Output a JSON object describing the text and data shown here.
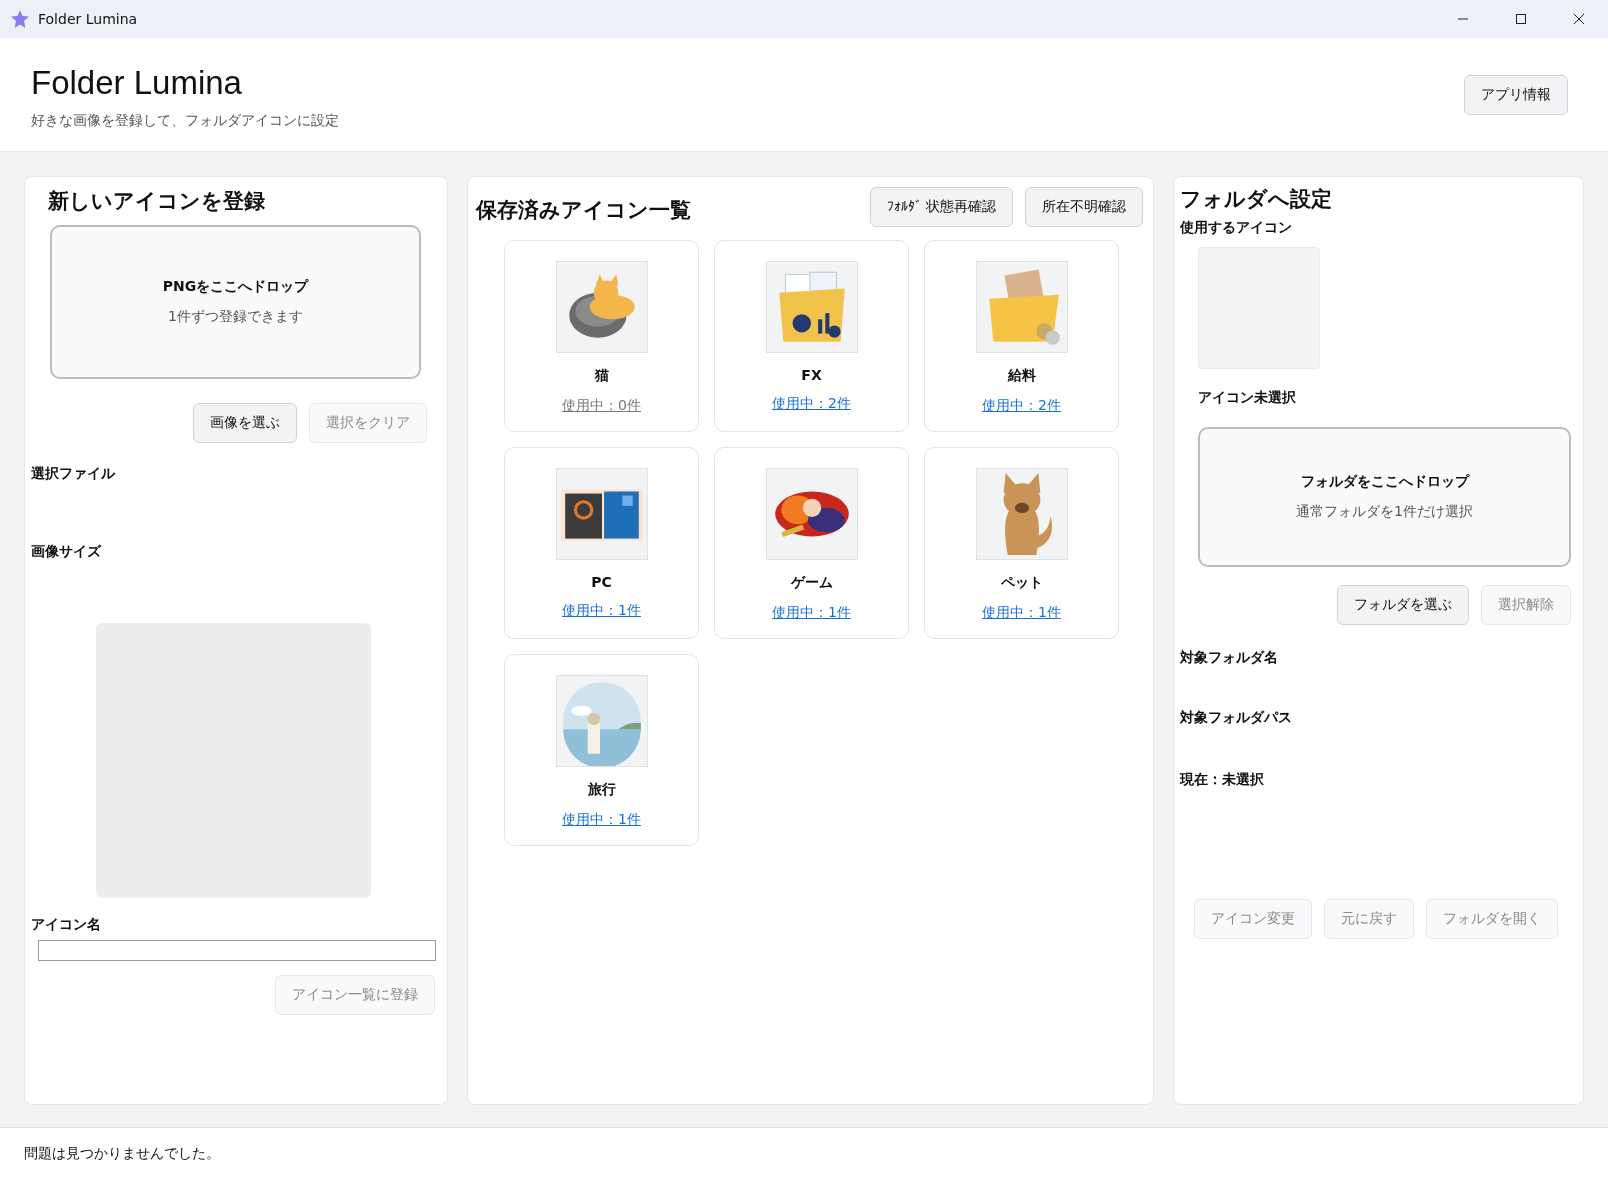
{
  "window": {
    "title": "Folder Lumina"
  },
  "header": {
    "title": "Folder Lumina",
    "subtitle": "好きな画像を登録して、フォルダアイコンに設定",
    "about_button": "アプリ情報"
  },
  "register_panel": {
    "title": "新しいアイコンを登録",
    "drop_title": "PNGをここへドロップ",
    "drop_hint": "1件ずつ登録できます",
    "buttons": [
      {
        "label": "画像を選ぶ",
        "disabled": false
      },
      {
        "label": "選択をクリア",
        "disabled": true
      }
    ],
    "file_label": "選択ファイル",
    "size_label": "画像サイズ",
    "name_label": "アイコン名",
    "register_button": {
      "label": "アイコン一覧に登録",
      "disabled": true
    }
  },
  "icons_panel": {
    "title": "保存済みアイコン一覧",
    "buttons": [
      {
        "label": "ﾌｫﾙﾀﾞ 状態再確認",
        "disabled": false
      },
      {
        "label": "所在不明確認",
        "disabled": false
      }
    ],
    "items": [
      {
        "name": "猫",
        "usage": "使用中：0件",
        "in_use": false
      },
      {
        "name": "FX",
        "usage": "使用中：2件",
        "in_use": true
      },
      {
        "name": "給料",
        "usage": "使用中：2件",
        "in_use": true
      },
      {
        "name": "PC",
        "usage": "使用中：1件",
        "in_use": true
      },
      {
        "name": "ゲーム",
        "usage": "使用中：1件",
        "in_use": true
      },
      {
        "name": "ペット",
        "usage": "使用中：1件",
        "in_use": true
      },
      {
        "name": "旅行",
        "usage": "使用中：1件",
        "in_use": true
      }
    ]
  },
  "folder_panel": {
    "title": "フォルダへ設定",
    "icon_label": "使用するアイコン",
    "icon_status": "アイコン未選択",
    "drop_title": "フォルダをここへドロップ",
    "drop_hint": "通常フォルダを1件だけ選択",
    "buttons": [
      {
        "label": "フォルダを選ぶ",
        "disabled": false
      },
      {
        "label": "選択解除",
        "disabled": true
      }
    ],
    "folder_name_label": "対象フォルダ名",
    "folder_path_label": "対象フォルダパス",
    "current": "現在：未選択",
    "actions": [
      {
        "label": "アイコン変更",
        "disabled": true
      },
      {
        "label": "元に戻す",
        "disabled": true
      },
      {
        "label": "フォルダを開く",
        "disabled": true
      }
    ]
  },
  "status_bar": {
    "message": "問題は見つかりませんでした。"
  }
}
